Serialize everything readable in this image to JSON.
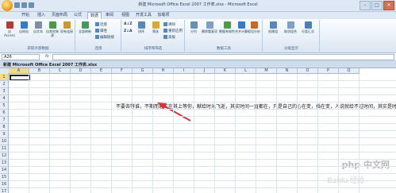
{
  "window": {
    "title": "新建 Microsoft Office Excel 2007 工作表.xlsx - Microsoft Excel",
    "minimize": "–",
    "maximize": "□",
    "close": "✕"
  },
  "tabs": [
    {
      "label": "开始"
    },
    {
      "label": "插入"
    },
    {
      "label": "页面布局"
    },
    {
      "label": "公式"
    },
    {
      "label": "数据"
    },
    {
      "label": "审阅"
    },
    {
      "label": "视图"
    },
    {
      "label": "开发工具"
    },
    {
      "label": "加载项"
    }
  ],
  "ribbon": {
    "group1": {
      "label": "获取外部数据",
      "b1": "自 Access",
      "b2": "自网站",
      "b3": "自文本",
      "b4": "自其他来源",
      "b5": "现有连接"
    },
    "group2": {
      "label": "连接",
      "b1": "全部刷新",
      "s1": "连接",
      "s2": "属性",
      "s3": "编辑链接"
    },
    "group3": {
      "label": "排序和筛选",
      "b1": "排序",
      "b2": "筛选",
      "s1": "清除",
      "s2": "重新应用",
      "s3": "高级"
    },
    "group4": {
      "label": "数据工具",
      "b1": "分列",
      "b2": "删除重复项",
      "b3": "数据有效性",
      "b4": "合并计算",
      "b5": "假设分析"
    },
    "group5": {
      "label": "分级显示",
      "b1": "创建组",
      "b2": "取消组合",
      "b3": "分类汇总"
    }
  },
  "formula_bar": {
    "name_box": "A26",
    "fx": "fx",
    "value": ""
  },
  "workbook": {
    "title": "新建 Microsoft Office Excel 2007 工作表.xlsx"
  },
  "grid": {
    "columns": [
      "A",
      "B",
      "C",
      "D",
      "E",
      "F",
      "G",
      "H",
      "I",
      "J",
      "K",
      "L",
      "M",
      "N",
      "O",
      "P",
      "Q"
    ],
    "rows": [
      "1",
      "2",
      "3",
      "4",
      "5",
      "6",
      "7",
      "8",
      "9",
      "10",
      "11",
      "12",
      "13",
      "14",
      "15",
      "16",
      "17"
    ],
    "cell_text": "不要去等谁，不期而遇王在其上等你，献给时光飞逝，其实时间一直都在，只是自己的心在变，插在变，人说就给不过时间，其实是时间就给不"
  },
  "watermark": {
    "text": "php 中文网",
    "text2": "Baidu 经验"
  },
  "colors": {
    "accent": "#dfe9f5",
    "arrow": "#d9333f",
    "selected_header": "#f7d98a"
  }
}
